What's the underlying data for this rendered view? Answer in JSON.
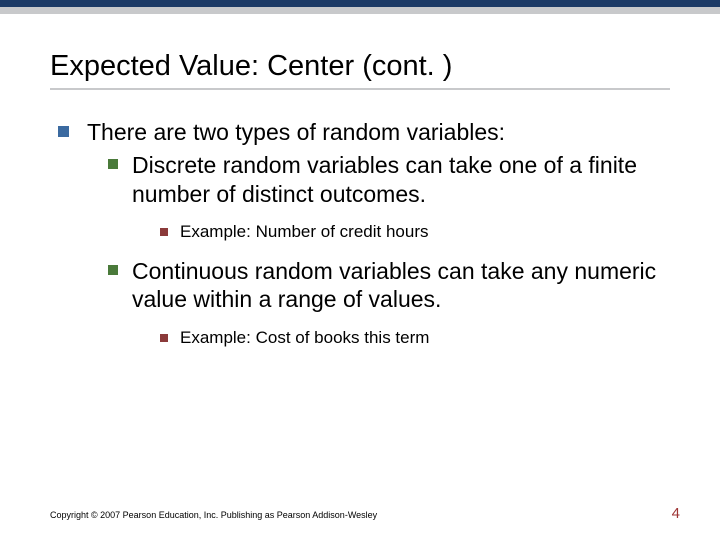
{
  "title": "Expected Value: Center (cont. )",
  "bullets": {
    "l1": "There are two types of random variables:",
    "l2a": "Discrete random variables can take one of a finite number of distinct outcomes.",
    "l3a": "Example: Number of credit hours",
    "l2b": "Continuous random variables can take any numeric value within a range of values.",
    "l3b": "Example: Cost of books this term"
  },
  "footer": "Copyright © 2007 Pearson Education, Inc. Publishing as Pearson Addison-Wesley",
  "pagenum": "4"
}
